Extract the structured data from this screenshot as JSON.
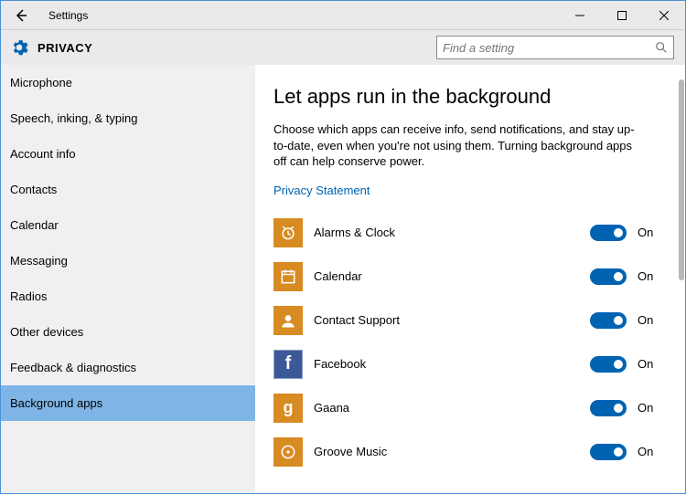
{
  "window": {
    "title": "Settings"
  },
  "header": {
    "category": "PRIVACY",
    "search_placeholder": "Find a setting"
  },
  "sidebar": {
    "items": [
      {
        "label": "Microphone",
        "selected": false
      },
      {
        "label": "Speech, inking, & typing",
        "selected": false
      },
      {
        "label": "Account info",
        "selected": false
      },
      {
        "label": "Contacts",
        "selected": false
      },
      {
        "label": "Calendar",
        "selected": false
      },
      {
        "label": "Messaging",
        "selected": false
      },
      {
        "label": "Radios",
        "selected": false
      },
      {
        "label": "Other devices",
        "selected": false
      },
      {
        "label": "Feedback & diagnostics",
        "selected": false
      },
      {
        "label": "Background apps",
        "selected": true
      }
    ]
  },
  "main": {
    "heading": "Let apps run in the background",
    "description": "Choose which apps can receive info, send notifications, and stay up-to-date, even when you're not using them. Turning background apps off can help conserve power.",
    "link": "Privacy Statement",
    "apps": [
      {
        "name": "Alarms & Clock",
        "icon": "alarm",
        "state": "On",
        "color": "#d78b22"
      },
      {
        "name": "Calendar",
        "icon": "calendar",
        "state": "On",
        "color": "#d78b22"
      },
      {
        "name": "Contact Support",
        "icon": "person",
        "state": "On",
        "color": "#d78b22"
      },
      {
        "name": "Facebook",
        "icon": "fb",
        "state": "On",
        "color": "#3b5998"
      },
      {
        "name": "Gaana",
        "icon": "g",
        "state": "On",
        "color": "#d78b22"
      },
      {
        "name": "Groove Music",
        "icon": "music",
        "state": "On",
        "color": "#d78b22"
      }
    ]
  }
}
